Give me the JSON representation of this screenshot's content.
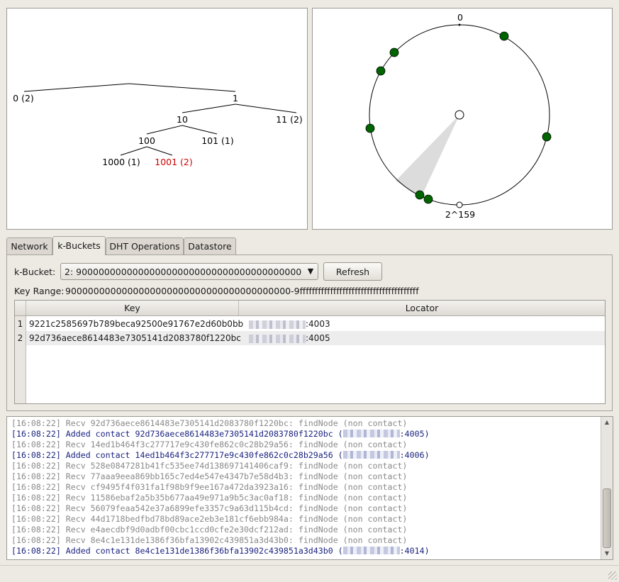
{
  "tree": {
    "nodes": {
      "n0": "0 (2)",
      "n1": "1",
      "n10": "10",
      "n11": "11 (2)",
      "n100": "100",
      "n101": "101 (1)",
      "n1000": "1000 (1)",
      "n1001": "1001 (2)"
    },
    "highlight_color": "#cc0000"
  },
  "ring": {
    "top_label": "0",
    "bottom_label": "2^159",
    "node_color": "#006400",
    "wedge_color": "#dcdcdc"
  },
  "tabs": [
    {
      "label": "Network",
      "active": false
    },
    {
      "label": "k-Buckets",
      "active": true
    },
    {
      "label": "DHT Operations",
      "active": false
    },
    {
      "label": "Datastore",
      "active": false
    }
  ],
  "kbuckets": {
    "bucket_label": "k-Bucket:",
    "bucket_value": "2: 9000000000000000000000000000000000000000",
    "refresh_label": "Refresh",
    "range_label": "Key Range:",
    "range_value": "9000000000000000000000000000000000000000-9fffffffffffffffffffffffffffffffffffffff",
    "columns": [
      "Key",
      "Locator"
    ],
    "rows": [
      {
        "num": "1",
        "key": "9221c2585697b789beca92500e91767e2d60b0bb",
        "port": ":4003"
      },
      {
        "num": "2",
        "key": "92d736aece8614483e7305141d2083780f1220bc",
        "port": ":4005"
      }
    ]
  },
  "log": [
    {
      "type": "recv",
      "text": "[16:08:22] Recv 92d736aece8614483e7305141d2083780f1220bc: findNode (non contact)"
    },
    {
      "type": "added",
      "text": "[16:08:22] Added contact 92d736aece8614483e7305141d2083780f1220bc (",
      "tail": ":4005)"
    },
    {
      "type": "recv",
      "text": "[16:08:22] Recv 14ed1b464f3c277717e9c430fe862c0c28b29a56: findNode (non contact)"
    },
    {
      "type": "added",
      "text": "[16:08:22] Added contact 14ed1b464f3c277717e9c430fe862c0c28b29a56 (",
      "tail": ":4006)"
    },
    {
      "type": "recv",
      "text": "[16:08:22] Recv 528e0847281b41fc535ee74d138697141406caf9: findNode (non contact)"
    },
    {
      "type": "recv",
      "text": "[16:08:22] Recv 77aaa9eea869bb165c7ed4e547e4347b7e58d4b3: findNode (non contact)"
    },
    {
      "type": "recv",
      "text": "[16:08:22] Recv cf9495f4f031fa1f98b9f9ee167a472da3923a16: findNode (non contact)"
    },
    {
      "type": "recv",
      "text": "[16:08:22] Recv 11586ebaf2a5b35b677aa49e971a9b5c3ac0af18: findNode (non contact)"
    },
    {
      "type": "recv",
      "text": "[16:08:22] Recv 56079feaa542e37a6899efe3357c9a63d115b4cd: findNode (non contact)"
    },
    {
      "type": "recv",
      "text": "[16:08:22] Recv 44d1718bedfbd78bd89ace2eb3e181cf6ebb984a: findNode (non contact)"
    },
    {
      "type": "recv",
      "text": "[16:08:22] Recv e4aecdbf9d0adbf00cbc1ccd0cfe2e30dcf212ad: findNode (non contact)"
    },
    {
      "type": "recv",
      "text": "[16:08:22] Recv 8e4c1e131de1386f36bfa13902c439851a3d43b0: findNode (non contact)"
    },
    {
      "type": "added",
      "text": "[16:08:22] Added contact 8e4c1e131de1386f36bfa13902c439851a3d43b0 (",
      "tail": ":4014)"
    }
  ]
}
